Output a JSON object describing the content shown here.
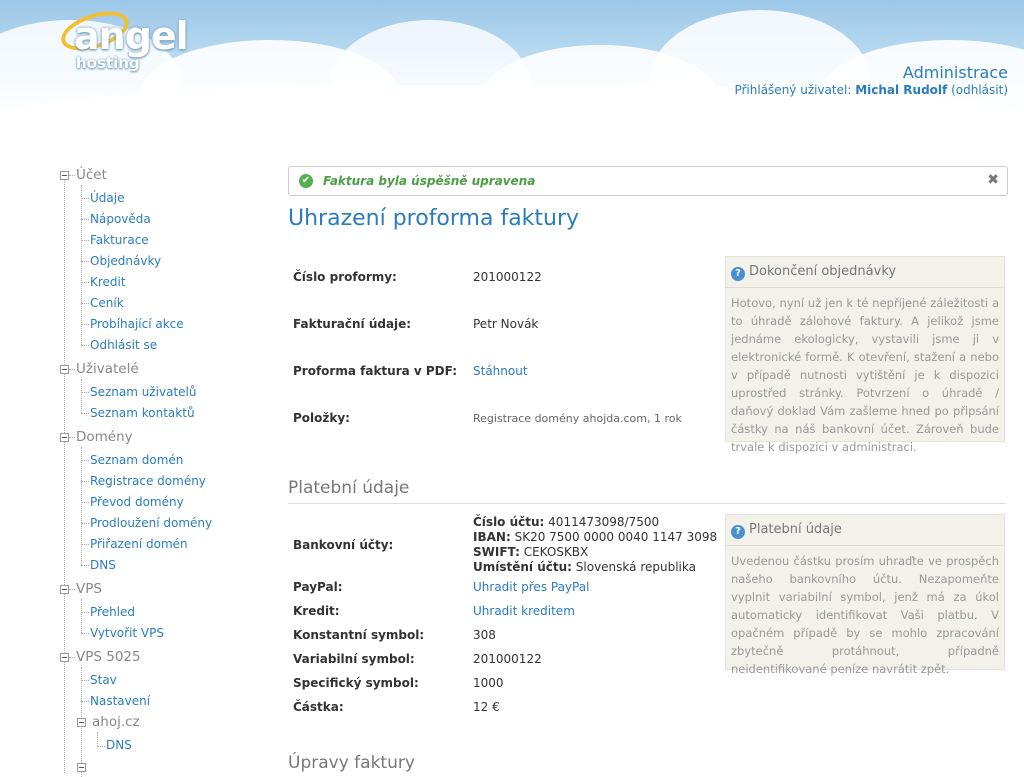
{
  "header": {
    "logo_top": "angel",
    "logo_bottom": "hosting",
    "admin_title": "Administrace",
    "user_prefix": "Přihlášený uživatel:",
    "user_name": "Michal Rudolf",
    "logout_link": "(odhlásit)"
  },
  "sidebar": {
    "ucet": "Účet",
    "ucet_items": [
      "Údaje",
      "Nápověda",
      "Fakturace",
      "Objednávky",
      "Kredit",
      "Ceník",
      "Probíhající akce",
      "Odhlásit se"
    ],
    "uzivatele": "Uživatelé",
    "uzivatele_items": [
      "Seznam uživatelů",
      "Seznam kontaktů"
    ],
    "domeny": "Domény",
    "domeny_items": [
      "Seznam domén",
      "Registrace domény",
      "Převod domény",
      "Prodloužení domény",
      "Přiřazení domén",
      "DNS"
    ],
    "vps": "VPS",
    "vps_items": [
      "Přehled",
      "Vytvořit VPS"
    ],
    "vps5025": "VPS 5025",
    "vps5025_items": [
      "Stav",
      "Nastavení"
    ],
    "ahoj": "ahoj.cz",
    "ahoj_items": [
      "DNS"
    ]
  },
  "alert": {
    "message": "Faktura byla úspěšně upravena"
  },
  "page": {
    "title": "Uhrazení proforma faktury",
    "proforma_no_label": "Číslo proformy:",
    "proforma_no": "201000122",
    "billing_label": "Fakturační údaje:",
    "billing_value": "Petr Novák",
    "pdf_label": "Proforma faktura v PDF:",
    "pdf_link": "Stáhnout",
    "items_label": "Položky:",
    "items_value": "Registrace domény ahojda.com, 1 rok"
  },
  "info1": {
    "title": "Dokončení objednávky",
    "text": "Hotovo, nyní už jen k té nepříjené záležitosti a to úhradě zálohové faktury. A jelikož jsme jednáme ekologicky, vystavili jsme ji v elektronické formě. K otevření, stažení a nebo v případě nutnosti vytištění je k dispozici uprostřed stránky. Potvrzení o úhradě / daňový doklad Vám zašleme hned po připsání částky na náš bankovní účet. Zároveň bude trvale k dispozici v administraci."
  },
  "payment": {
    "section_title": "Platební údaje",
    "bank_label": "Bankovní účty:",
    "acct_label": "Číslo účtu:",
    "acct_value": "4011473098/7500",
    "iban_label": "IBAN:",
    "iban_value": "SK20 7500 0000 0040 1147 3098",
    "swift_label": "SWIFT:",
    "swift_value": "CEKOSKBX",
    "location_label": "Umístění účtu:",
    "location_value": "Slovenská republika",
    "paypal_label": "PayPal:",
    "paypal_link": "Uhradit přes PayPal",
    "credit_label": "Kredit:",
    "credit_link": "Uhradit kreditem",
    "const_label": "Konstantní symbol:",
    "const_value": "308",
    "var_label": "Variabilní symbol:",
    "var_value": "201000122",
    "spec_label": "Specifický symbol:",
    "spec_value": "1000",
    "amount_label": "Částka:",
    "amount_value": "12 €"
  },
  "info2": {
    "title": "Platební údaje",
    "text": "Uvedenou částku prosím uhraďte ve prospěch našeho bankovního účtu. Nezapomeňte vyplnit variabilní symbol, jenž má za úkol automaticky identifikovat Vaši platbu. V opačném případě by se mohlo zpracování zbytečně protáhnout, případně neidentifikované peníze navrátit zpět."
  },
  "edits": {
    "section_title": "Úpravy faktury"
  }
}
